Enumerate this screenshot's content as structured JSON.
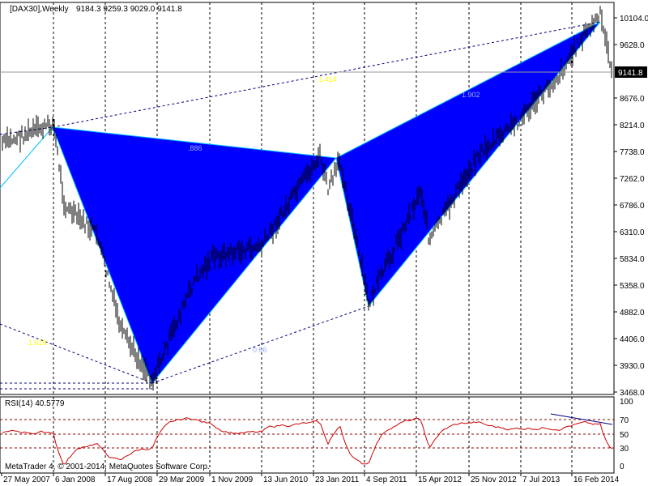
{
  "header": {
    "symbol": "[DAX30],Weekly",
    "ohlc": "9184.3 9259.3 9029.0 9141.8"
  },
  "price_badge": "9141.8",
  "rsi": {
    "label": "RSI(14) 40.5779",
    "levels": [
      "100",
      "70",
      "50",
      "30",
      "0"
    ]
  },
  "copyright": "MetaTrader 4, © 2001-2014, MetaQuotes Software Corp.",
  "colors": {
    "pattern_fill": "#0000FF",
    "pattern_edge": "#00BFFF",
    "rsi_line": "#CC0000",
    "rsi_level": "#8B0000",
    "trend": "#000080",
    "ratio_text": "#FFFF00"
  },
  "chart_data": {
    "type": "bar",
    "title": "[DAX30],Weekly",
    "y_ticks": [
      "10104.0",
      "9628.0",
      "9141.8",
      "8676.0",
      "8214.0",
      "7738.0",
      "7262.0",
      "6786.0",
      "6310.0",
      "5834.0",
      "5358.0",
      "4882.0",
      "4406.0",
      "3930.0",
      "3468.0"
    ],
    "y_values": [
      10104.0,
      9628.0,
      8676.0,
      8214.0,
      7738.0,
      7262.0,
      6786.0,
      6310.0,
      5834.0,
      5358.0,
      4882.0,
      4406.0,
      3930.0,
      3468.0
    ],
    "ylim": [
      3400,
      10280
    ],
    "x_ticks": [
      "27 May 2007",
      "6 Jan 2008",
      "17 Aug 2008",
      "29 Mar 2009",
      "1 Nov 2009",
      "13 Jun 2010",
      "23 Jan 2011",
      "4 Sep 2011",
      "15 Apr 2012",
      "25 Nov 2012",
      "7 Jul 2013",
      "16 Feb 2014"
    ],
    "current_price": 9141.8,
    "ratios": [
      {
        "text": ".886"
      },
      {
        "text": "1.414"
      },
      {
        "text": "1.902"
      },
      {
        "text": "1.618"
      },
      {
        "text": "0.66"
      }
    ],
    "price_path": [
      [
        "27 May 2007",
        7800
      ],
      [
        "6 Jan 2008",
        8150
      ],
      [
        "Feb 2008",
        6700
      ],
      [
        "Jun 2008",
        6200
      ],
      [
        "Oct 2008",
        4500
      ],
      [
        "Mar 2009",
        3650
      ],
      [
        "Aug 2009",
        5400
      ],
      [
        "Jan 2010",
        5800
      ],
      [
        "Jun 2010",
        6000
      ],
      [
        "Jan 2011",
        7600
      ],
      [
        "Mar 2011",
        7000
      ],
      [
        "Jun 2011",
        7500
      ],
      [
        "Sep 2011",
        5000
      ],
      [
        "Mar 2012",
        7000
      ],
      [
        "Jun 2012",
        6100
      ],
      [
        "Dec 2012",
        7600
      ],
      [
        "Jun 2013",
        8200
      ],
      [
        "Oct 2013",
        9000
      ],
      [
        "Jan 2014",
        9700
      ],
      [
        "May 2014",
        10050
      ],
      [
        "Jul 2014",
        9141.8
      ]
    ]
  }
}
